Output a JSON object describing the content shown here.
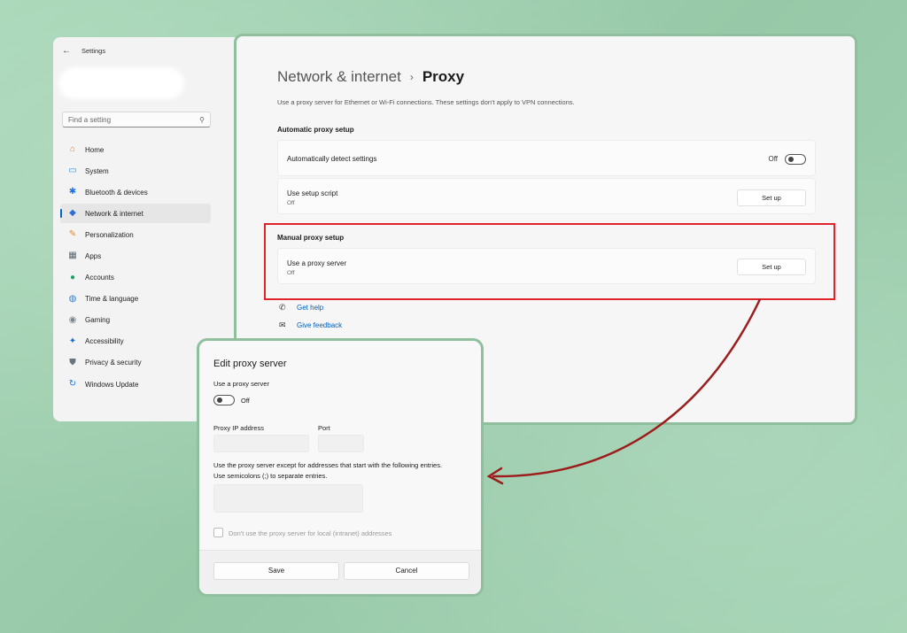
{
  "window": {
    "title": "Settings"
  },
  "search": {
    "placeholder": "Find a setting"
  },
  "sidebar": {
    "items": [
      {
        "label": "Home",
        "icon": "home-icon",
        "glyph": "⌂",
        "color": "#e07b39"
      },
      {
        "label": "System",
        "icon": "system-icon",
        "glyph": "▭",
        "color": "#2a8be8"
      },
      {
        "label": "Bluetooth & devices",
        "icon": "bluetooth-icon",
        "glyph": "✱",
        "color": "#1a73e8"
      },
      {
        "label": "Network & internet",
        "icon": "wifi-icon",
        "glyph": "◆",
        "color": "#2b6fd6"
      },
      {
        "label": "Personalization",
        "icon": "brush-icon",
        "glyph": "✎",
        "color": "#e28a2b"
      },
      {
        "label": "Apps",
        "icon": "apps-icon",
        "glyph": "▦",
        "color": "#5a6570"
      },
      {
        "label": "Accounts",
        "icon": "accounts-icon",
        "glyph": "●",
        "color": "#1fa36b"
      },
      {
        "label": "Time & language",
        "icon": "globe-icon",
        "glyph": "◍",
        "color": "#2c7fd1"
      },
      {
        "label": "Gaming",
        "icon": "gamepad-icon",
        "glyph": "◉",
        "color": "#7a8590"
      },
      {
        "label": "Accessibility",
        "icon": "accessibility-icon",
        "glyph": "✦",
        "color": "#1a6fd6"
      },
      {
        "label": "Privacy & security",
        "icon": "shield-icon",
        "glyph": "⛊",
        "color": "#6b7580"
      },
      {
        "label": "Windows Update",
        "icon": "update-icon",
        "glyph": "↻",
        "color": "#1a73e8"
      }
    ],
    "active_index": 3
  },
  "main": {
    "breadcrumb_parent": "Network & internet",
    "breadcrumb_sep": "›",
    "breadcrumb_current": "Proxy",
    "description": "Use a proxy server for Ethernet or Wi-Fi connections. These settings don't apply to VPN connections.",
    "auto_section": "Automatic proxy setup",
    "auto_detect_label": "Automatically detect settings",
    "auto_detect_state": "Off",
    "setup_script_label": "Use setup script",
    "setup_script_state": "Off",
    "setup_button": "Set up",
    "manual_section": "Manual proxy setup",
    "proxy_server_label": "Use a proxy server",
    "proxy_server_state": "Off",
    "get_help": "Get help",
    "give_feedback": "Give feedback"
  },
  "dialog": {
    "title": "Edit proxy server",
    "use_proxy_label": "Use a proxy server",
    "toggle_state": "Off",
    "ip_label": "Proxy IP address",
    "port_label": "Port",
    "exceptions_text_1": "Use the proxy server except for addresses that start with the following entries.",
    "exceptions_text_2": "Use semicolons (;) to separate entries.",
    "local_checkbox_label": "Don't use the proxy server for local (intranet) addresses",
    "save": "Save",
    "cancel": "Cancel"
  },
  "colors": {
    "accent": "#0067c0",
    "highlight": "#e0242a",
    "arrow": "#9b1d1d"
  }
}
